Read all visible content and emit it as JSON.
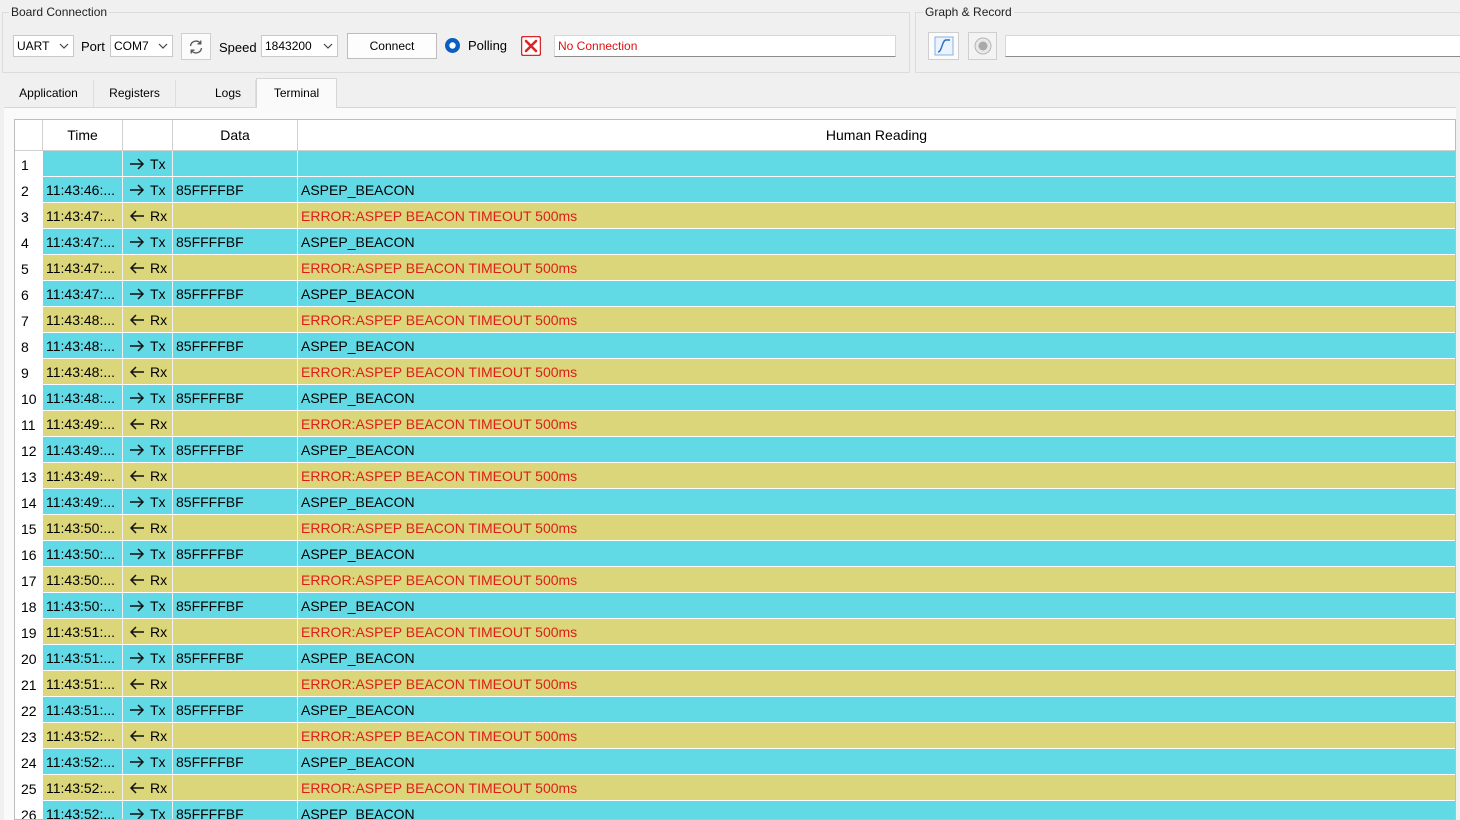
{
  "board_connection": {
    "title": "Board Connection",
    "protocol": "UART",
    "port_label": "Port",
    "port": "COM7",
    "speed_label": "Speed",
    "speed": "1843200",
    "connect_label": "Connect",
    "polling_label": "Polling",
    "status_text": "No Connection"
  },
  "graph_record": {
    "title": "Graph & Record",
    "path_value": ""
  },
  "tabs": [
    "Application",
    "Registers",
    "Logs",
    "Terminal"
  ],
  "active_tab": "Terminal",
  "table": {
    "headers": {
      "time": "Time",
      "dir": "",
      "data": "Data",
      "human": "Human Reading"
    },
    "rows": [
      {
        "n": "1",
        "time": "",
        "dir": "Tx",
        "data": "",
        "human": ""
      },
      {
        "n": "2",
        "time": "11:43:46:...",
        "dir": "Tx",
        "data": "85FFFFBF",
        "human": "ASPEP_BEACON"
      },
      {
        "n": "3",
        "time": "11:43:47:...",
        "dir": "Rx",
        "data": "",
        "human": "ERROR:ASPEP BEACON TIMEOUT 500ms"
      },
      {
        "n": "4",
        "time": "11:43:47:...",
        "dir": "Tx",
        "data": "85FFFFBF",
        "human": "ASPEP_BEACON"
      },
      {
        "n": "5",
        "time": "11:43:47:...",
        "dir": "Rx",
        "data": "",
        "human": "ERROR:ASPEP BEACON TIMEOUT 500ms"
      },
      {
        "n": "6",
        "time": "11:43:47:...",
        "dir": "Tx",
        "data": "85FFFFBF",
        "human": "ASPEP_BEACON"
      },
      {
        "n": "7",
        "time": "11:43:48:...",
        "dir": "Rx",
        "data": "",
        "human": "ERROR:ASPEP BEACON TIMEOUT 500ms"
      },
      {
        "n": "8",
        "time": "11:43:48:...",
        "dir": "Tx",
        "data": "85FFFFBF",
        "human": "ASPEP_BEACON"
      },
      {
        "n": "9",
        "time": "11:43:48:...",
        "dir": "Rx",
        "data": "",
        "human": "ERROR:ASPEP BEACON TIMEOUT 500ms"
      },
      {
        "n": "10",
        "time": "11:43:48:...",
        "dir": "Tx",
        "data": "85FFFFBF",
        "human": "ASPEP_BEACON"
      },
      {
        "n": "11",
        "time": "11:43:49:...",
        "dir": "Rx",
        "data": "",
        "human": "ERROR:ASPEP BEACON TIMEOUT 500ms"
      },
      {
        "n": "12",
        "time": "11:43:49:...",
        "dir": "Tx",
        "data": "85FFFFBF",
        "human": "ASPEP_BEACON"
      },
      {
        "n": "13",
        "time": "11:43:49:...",
        "dir": "Rx",
        "data": "",
        "human": "ERROR:ASPEP BEACON TIMEOUT 500ms"
      },
      {
        "n": "14",
        "time": "11:43:49:...",
        "dir": "Tx",
        "data": "85FFFFBF",
        "human": "ASPEP_BEACON"
      },
      {
        "n": "15",
        "time": "11:43:50:...",
        "dir": "Rx",
        "data": "",
        "human": "ERROR:ASPEP BEACON TIMEOUT 500ms"
      },
      {
        "n": "16",
        "time": "11:43:50:...",
        "dir": "Tx",
        "data": "85FFFFBF",
        "human": "ASPEP_BEACON"
      },
      {
        "n": "17",
        "time": "11:43:50:...",
        "dir": "Rx",
        "data": "",
        "human": "ERROR:ASPEP BEACON TIMEOUT 500ms"
      },
      {
        "n": "18",
        "time": "11:43:50:...",
        "dir": "Tx",
        "data": "85FFFFBF",
        "human": "ASPEP_BEACON"
      },
      {
        "n": "19",
        "time": "11:43:51:...",
        "dir": "Rx",
        "data": "",
        "human": "ERROR:ASPEP BEACON TIMEOUT 500ms"
      },
      {
        "n": "20",
        "time": "11:43:51:...",
        "dir": "Tx",
        "data": "85FFFFBF",
        "human": "ASPEP_BEACON"
      },
      {
        "n": "21",
        "time": "11:43:51:...",
        "dir": "Rx",
        "data": "",
        "human": "ERROR:ASPEP BEACON TIMEOUT 500ms"
      },
      {
        "n": "22",
        "time": "11:43:51:...",
        "dir": "Tx",
        "data": "85FFFFBF",
        "human": "ASPEP_BEACON"
      },
      {
        "n": "23",
        "time": "11:43:52:...",
        "dir": "Rx",
        "data": "",
        "human": "ERROR:ASPEP BEACON TIMEOUT 500ms"
      },
      {
        "n": "24",
        "time": "11:43:52:...",
        "dir": "Tx",
        "data": "85FFFFBF",
        "human": "ASPEP_BEACON"
      },
      {
        "n": "25",
        "time": "11:43:52:...",
        "dir": "Rx",
        "data": "",
        "human": "ERROR:ASPEP BEACON TIMEOUT 500ms"
      },
      {
        "n": "26",
        "time": "11:43:52:...",
        "dir": "Tx",
        "data": "85FFFFBF",
        "human": "ASPEP_BEACON"
      }
    ]
  },
  "colors": {
    "tx_row": "#62dae6",
    "rx_row": "#dcd67a",
    "error_text": "#e01c1c",
    "status_text": "#e01010",
    "polling_radio": "#0b5fbf",
    "disconnect_icon": "#d9262a"
  },
  "icons": {
    "refresh": "refresh-icon",
    "polling": "radio-selected-icon",
    "disconnected": "disconnected-x-icon",
    "graph": "graph-curve-icon",
    "record": "record-icon",
    "tx": "arrow-right-icon",
    "rx": "arrow-left-icon"
  }
}
